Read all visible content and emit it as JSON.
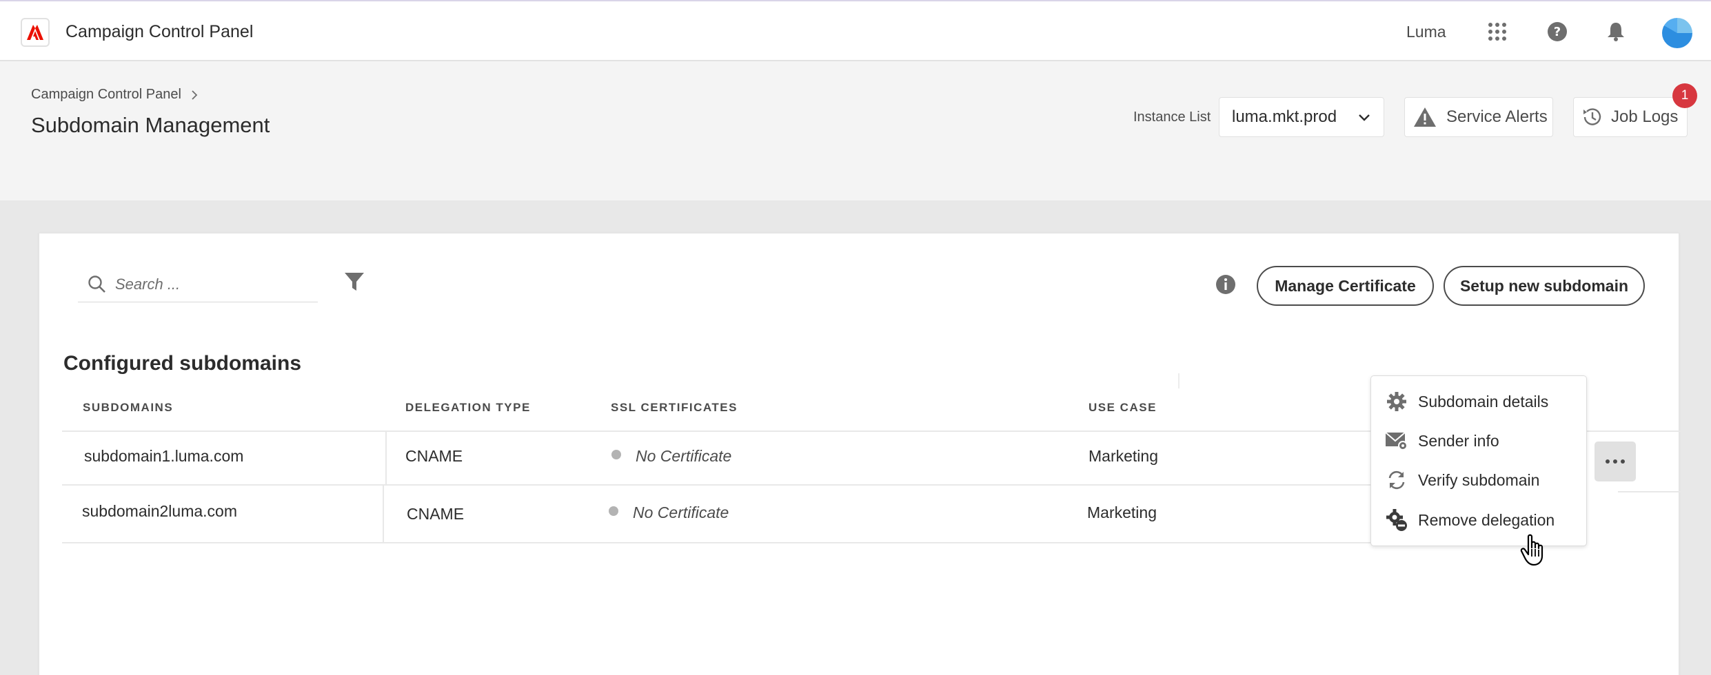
{
  "header": {
    "app_title": "Campaign Control Panel",
    "org_name": "Luma",
    "logo_icon": "adobe-logo-icon",
    "icons": [
      "apps-grid-icon",
      "help-icon",
      "bell-icon"
    ],
    "brand_color": "#eb1000"
  },
  "page": {
    "breadcrumb": "Campaign Control Panel",
    "title": "Subdomain Management",
    "instance_label": "Instance List",
    "instance_value": "luma.mkt.prod",
    "service_alerts_label": "Service Alerts",
    "job_logs_label": "Job Logs",
    "job_logs_badge": "1",
    "badge_color": "#d7373f"
  },
  "toolbar": {
    "search_placeholder": "Search ...",
    "manage_certificate_label": "Manage Certificate",
    "setup_subdomain_label": "Setup new subdomain"
  },
  "table": {
    "title": "Configured subdomains",
    "columns": [
      "SUBDOMAINS",
      "DELEGATION TYPE",
      "SSL CERTIFICATES",
      "USE CASE"
    ],
    "rows": [
      {
        "subdomain": "subdomain1.luma.com",
        "delegation": "CNAME",
        "ssl": "No Certificate",
        "use_case": "Marketing"
      },
      {
        "subdomain": "subdomain2luma.com",
        "delegation": "CNAME",
        "ssl": "No Certificate",
        "use_case": "Marketing"
      }
    ]
  },
  "context_menu": {
    "items": [
      {
        "label": "Subdomain details",
        "icon": "gear-icon"
      },
      {
        "label": "Sender info",
        "icon": "mail-settings-icon"
      },
      {
        "label": "Verify subdomain",
        "icon": "refresh-icon"
      },
      {
        "label": "Remove delegation",
        "icon": "gear-remove-icon"
      }
    ]
  }
}
